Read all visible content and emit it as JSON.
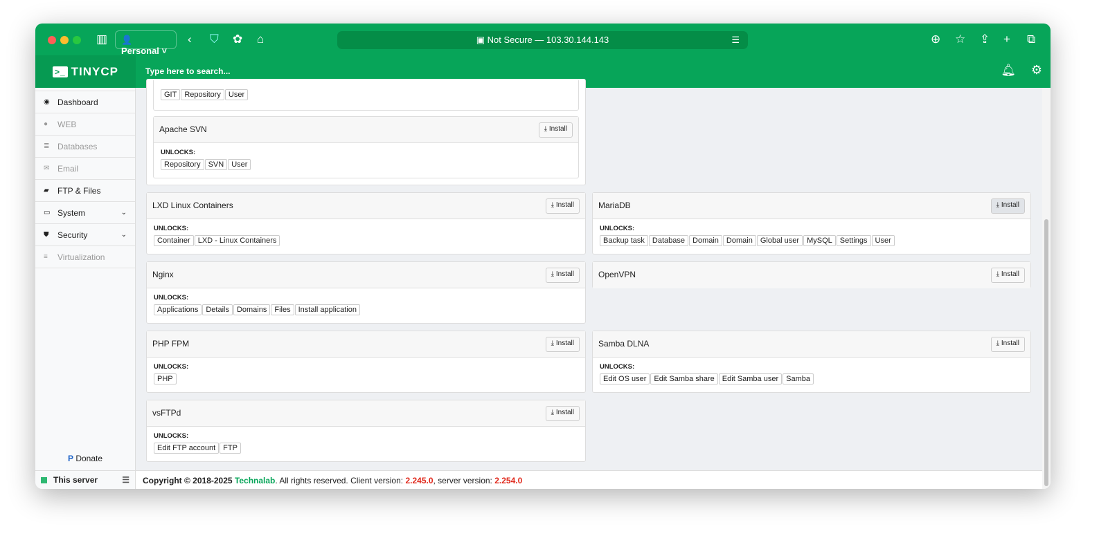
{
  "browser": {
    "profile": "Personal",
    "url": "Not Secure — 103.30.144.143"
  },
  "app": {
    "logo": "TINYCP",
    "search_placeholder": "Type here to search..."
  },
  "sidebar": {
    "items": [
      {
        "label": "Dashboard",
        "icon": "dashboard-icon",
        "disabled": false
      },
      {
        "label": "WEB",
        "icon": "globe-icon",
        "disabled": true
      },
      {
        "label": "Databases",
        "icon": "database-icon",
        "disabled": true
      },
      {
        "label": "Email",
        "icon": "envelope-icon",
        "disabled": true
      },
      {
        "label": "FTP & Files",
        "icon": "folder-icon",
        "disabled": false
      },
      {
        "label": "System",
        "icon": "hdd-icon",
        "disabled": false,
        "chevron": true
      },
      {
        "label": "Security",
        "icon": "shield-icon",
        "disabled": false,
        "chevron": true
      },
      {
        "label": "Virtualization",
        "icon": "server-icon",
        "disabled": true
      }
    ],
    "donate": "Donate",
    "server": "This server"
  },
  "unlocks_label": "UNLOCKS:",
  "install_label": "Install",
  "top_group": {
    "first_tags": [
      "GIT",
      "Repository",
      "User"
    ],
    "svn": {
      "title": "Apache SVN",
      "tags": [
        "Repository",
        "SVN",
        "User"
      ]
    }
  },
  "cards": [
    {
      "title": "LXD Linux Containers",
      "tags": [
        "Container",
        "LXD - Linux Containers"
      ]
    },
    {
      "title": "MariaDB",
      "tags": [
        "Backup task",
        "Database",
        "Domain",
        "Domain",
        "Global user",
        "MySQL",
        "Settings",
        "User"
      ]
    },
    {
      "title": "Nginx",
      "tags": [
        "Applications",
        "Details",
        "Domains",
        "Files",
        "Install application"
      ]
    },
    {
      "title": "OpenVPN",
      "tags": []
    },
    {
      "title": "PHP FPM",
      "tags": [
        "PHP"
      ]
    },
    {
      "title": "Samba DLNA",
      "tags": [
        "Edit OS user",
        "Edit Samba share",
        "Edit Samba user",
        "Samba"
      ]
    },
    {
      "title": "vsFTPd",
      "tags": [
        "Edit FTP account",
        "FTP"
      ]
    }
  ],
  "footer": {
    "prefix": "Copyright © 2018-2025",
    "company": "Technalab",
    "mid": ". All rights reserved. Client version:",
    "client": "2.245.0",
    "mid2": ", server version:",
    "server": "2.254.0"
  },
  "colors": {
    "brand": "#07a559",
    "version": "#e0281b"
  }
}
